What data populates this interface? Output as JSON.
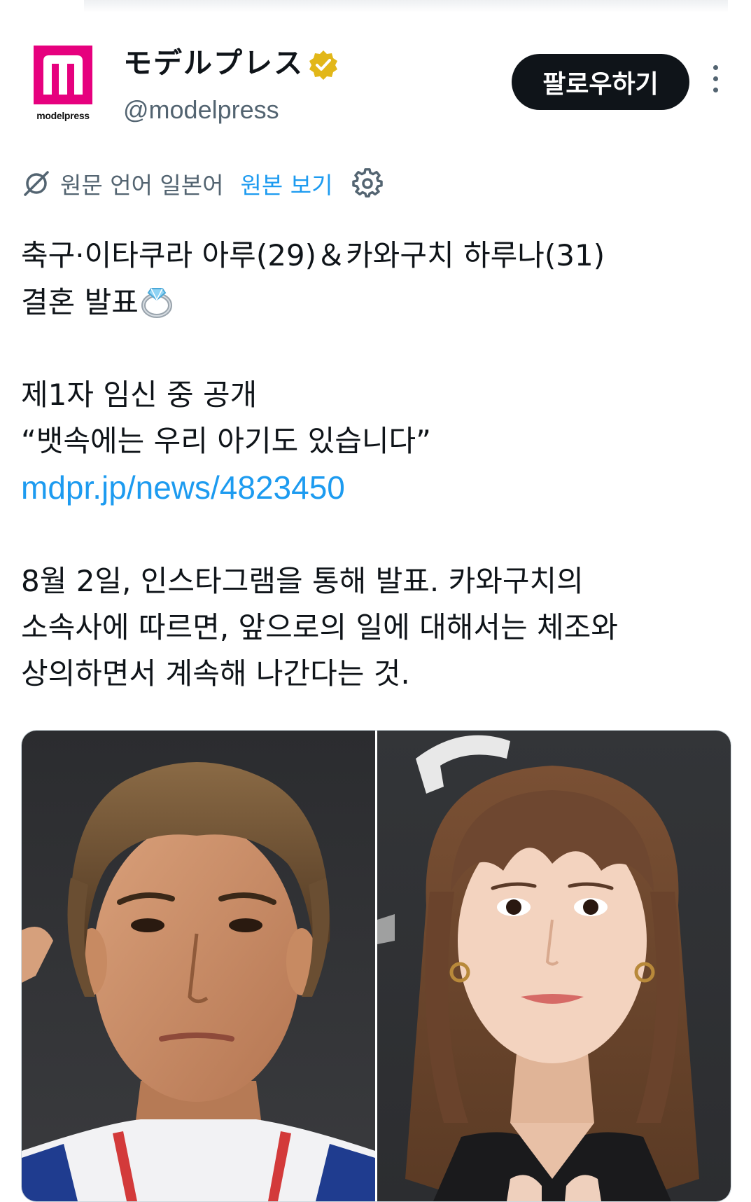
{
  "account": {
    "display_name": "モデルプレス",
    "handle": "@modelpress",
    "logo_text": "modelpress",
    "verified_icon": "verified-badge-gold",
    "follow_label": "팔로우하기",
    "more_icon": "more-vertical-icon"
  },
  "translation": {
    "icon": "translate-icon",
    "source_text": "원문 언어 일본어",
    "view_original_label": "원본 보기",
    "settings_icon": "gear-icon"
  },
  "tweet": {
    "line1": "축구·이타쿠라 아루(29)＆카와구치 하루나(31)",
    "line2": "결혼 발표",
    "line2_emoji": "ring-icon",
    "line3": "제1자 임신 중 공개",
    "line4": "“뱃속에는 우리 아기도 있습니다”",
    "link": "mdpr.jp/news/4823450",
    "line5": "8월 2일, 인스타그램을 통해 발표. 카와구치의",
    "line6": "소속사에 따르면, 앞으로의 일에 대해서는 체조와",
    "line7": "상의하면서 계속해 나간다는 것."
  },
  "media": {
    "left_photo": "man-portrait-photo",
    "right_photo": "woman-portrait-photo"
  },
  "colors": {
    "brand_magenta": "#e6007e",
    "link_blue": "#1d9bf0",
    "verified_gold": "#e2b719",
    "text_primary": "#0f1419",
    "text_secondary": "#536471"
  }
}
